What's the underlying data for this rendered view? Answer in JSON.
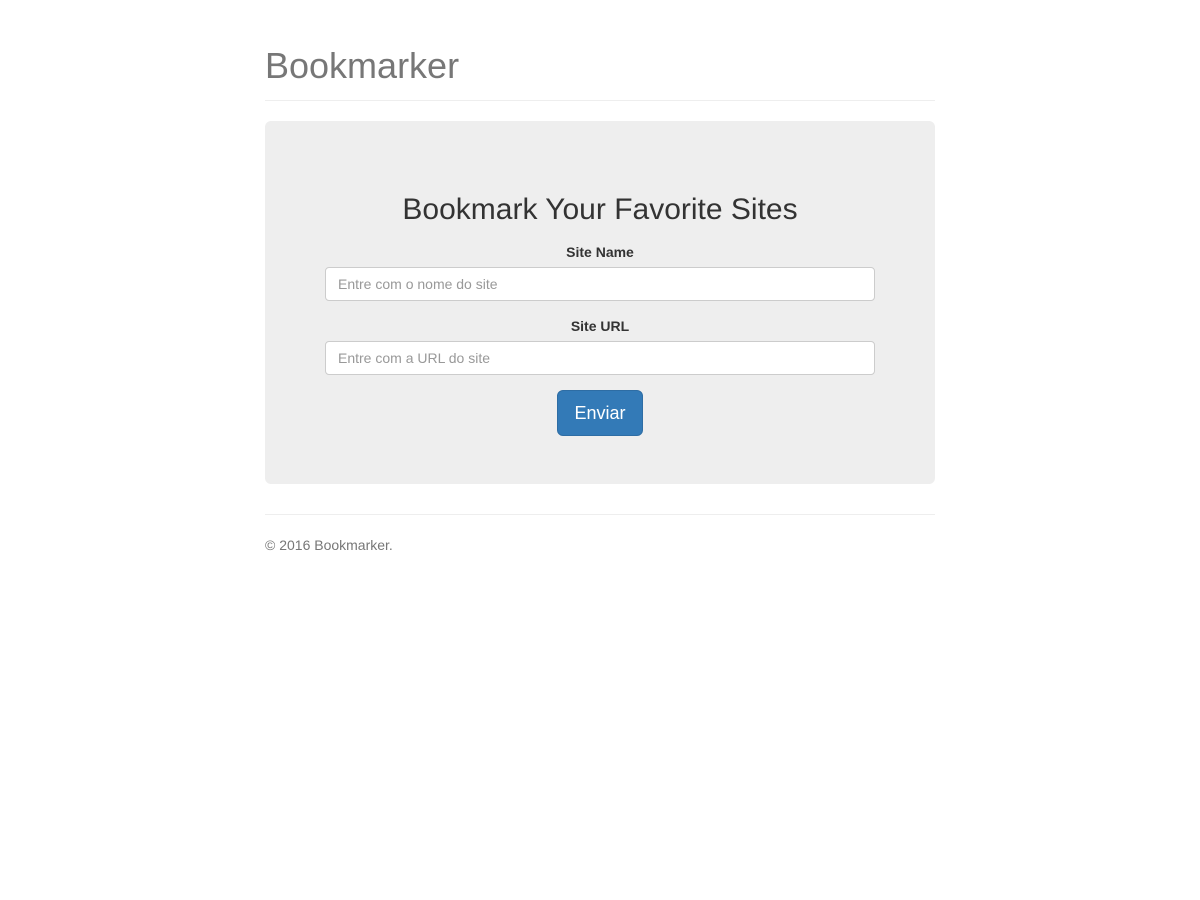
{
  "header": {
    "title": "Bookmarker"
  },
  "main": {
    "heading": "Bookmark Your Favorite Sites",
    "form": {
      "site_name": {
        "label": "Site Name",
        "placeholder": "Entre com o nome do site",
        "value": ""
      },
      "site_url": {
        "label": "Site URL",
        "placeholder": "Entre com a URL do site",
        "value": ""
      },
      "submit_label": "Enviar"
    }
  },
  "footer": {
    "copyright": "© 2016 Bookmarker."
  }
}
